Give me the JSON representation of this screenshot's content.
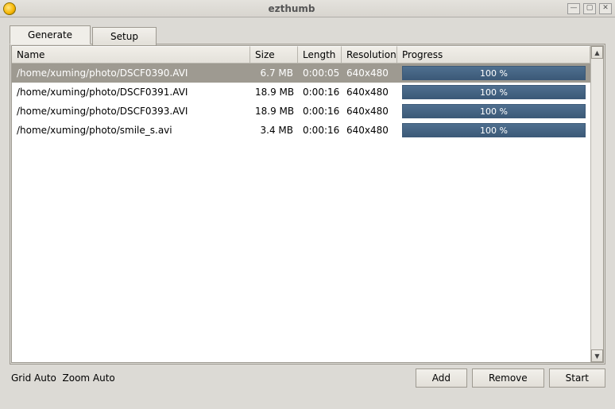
{
  "window": {
    "title": "ezthumb"
  },
  "tabs": {
    "generate": "Generate",
    "setup": "Setup"
  },
  "columns": {
    "name": "Name",
    "size": "Size",
    "length": "Length",
    "resolution": "Resolution",
    "progress": "Progress"
  },
  "rows": [
    {
      "name": "/home/xuming/photo/DSCF0390.AVI",
      "size": "6.7 MB",
      "length": "0:00:05",
      "resolution": "640x480",
      "progress": "100 %",
      "selected": true
    },
    {
      "name": "/home/xuming/photo/DSCF0391.AVI",
      "size": "18.9 MB",
      "length": "0:00:16",
      "resolution": "640x480",
      "progress": "100 %",
      "selected": false
    },
    {
      "name": "/home/xuming/photo/DSCF0393.AVI",
      "size": "18.9 MB",
      "length": "0:00:16",
      "resolution": "640x480",
      "progress": "100 %",
      "selected": false
    },
    {
      "name": "/home/xuming/photo/smile_s.avi",
      "size": "3.4 MB",
      "length": "0:00:16",
      "resolution": "640x480",
      "progress": "100 %",
      "selected": false
    }
  ],
  "status": {
    "grid": "Grid Auto",
    "zoom": "Zoom Auto"
  },
  "buttons": {
    "add": "Add",
    "remove": "Remove",
    "start": "Start"
  }
}
